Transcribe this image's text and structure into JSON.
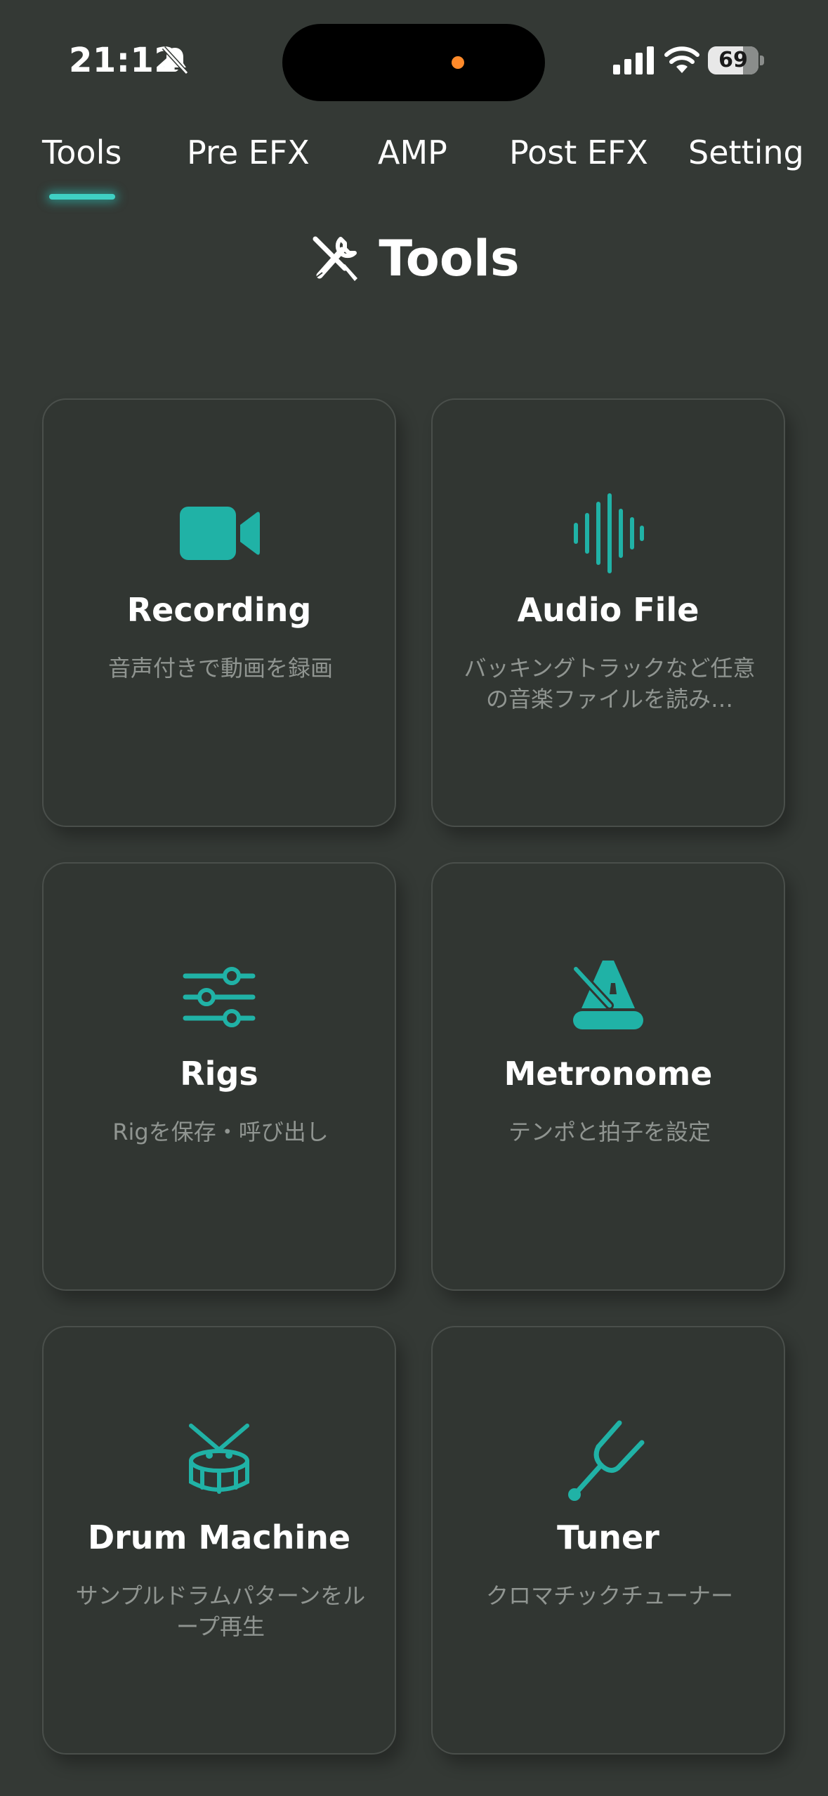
{
  "status_bar": {
    "time": "21:12",
    "battery_level": 69,
    "battery_text": "69"
  },
  "tabs": [
    {
      "label": "Tools",
      "active": true
    },
    {
      "label": "Pre EFX",
      "active": false
    },
    {
      "label": "AMP",
      "active": false
    },
    {
      "label": "Post EFX",
      "active": false
    },
    {
      "label": "Setting",
      "active": false
    }
  ],
  "page": {
    "title": "Tools",
    "title_icon": "tools-icon"
  },
  "cards": [
    {
      "icon": "video-camera-icon",
      "title": "Recording",
      "desc": "音声付きで動画を録画"
    },
    {
      "icon": "waveform-icon",
      "title": "Audio File",
      "desc": "バッキングトラックなど任意の音楽ファイルを読み…"
    },
    {
      "icon": "sliders-icon",
      "title": "Rigs",
      "desc": "Rigを保存・呼び出し"
    },
    {
      "icon": "metronome-icon",
      "title": "Metronome",
      "desc": "テンポと拍子を設定"
    },
    {
      "icon": "drum-icon",
      "title": "Drum Machine",
      "desc": "サンプルドラムパターンをループ再生"
    },
    {
      "icon": "tuning-fork-icon",
      "title": "Tuner",
      "desc": "クロマチックチューナー"
    }
  ],
  "colors": {
    "background": "#343935",
    "card": "#313632",
    "accent": "#20b2a6",
    "text_muted": "#909591"
  }
}
